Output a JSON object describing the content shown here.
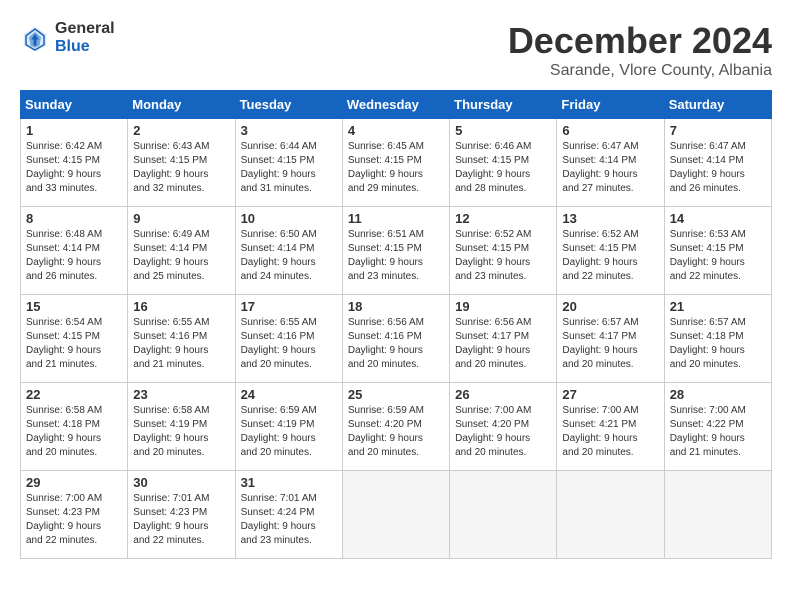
{
  "header": {
    "logo_general": "General",
    "logo_blue": "Blue",
    "month_title": "December 2024",
    "subtitle": "Sarande, Vlore County, Albania"
  },
  "weekdays": [
    "Sunday",
    "Monday",
    "Tuesday",
    "Wednesday",
    "Thursday",
    "Friday",
    "Saturday"
  ],
  "weeks": [
    [
      {
        "day": "1",
        "info": "Sunrise: 6:42 AM\nSunset: 4:15 PM\nDaylight: 9 hours\nand 33 minutes."
      },
      {
        "day": "2",
        "info": "Sunrise: 6:43 AM\nSunset: 4:15 PM\nDaylight: 9 hours\nand 32 minutes."
      },
      {
        "day": "3",
        "info": "Sunrise: 6:44 AM\nSunset: 4:15 PM\nDaylight: 9 hours\nand 31 minutes."
      },
      {
        "day": "4",
        "info": "Sunrise: 6:45 AM\nSunset: 4:15 PM\nDaylight: 9 hours\nand 29 minutes."
      },
      {
        "day": "5",
        "info": "Sunrise: 6:46 AM\nSunset: 4:15 PM\nDaylight: 9 hours\nand 28 minutes."
      },
      {
        "day": "6",
        "info": "Sunrise: 6:47 AM\nSunset: 4:14 PM\nDaylight: 9 hours\nand 27 minutes."
      },
      {
        "day": "7",
        "info": "Sunrise: 6:47 AM\nSunset: 4:14 PM\nDaylight: 9 hours\nand 26 minutes."
      }
    ],
    [
      {
        "day": "8",
        "info": "Sunrise: 6:48 AM\nSunset: 4:14 PM\nDaylight: 9 hours\nand 26 minutes."
      },
      {
        "day": "9",
        "info": "Sunrise: 6:49 AM\nSunset: 4:14 PM\nDaylight: 9 hours\nand 25 minutes."
      },
      {
        "day": "10",
        "info": "Sunrise: 6:50 AM\nSunset: 4:14 PM\nDaylight: 9 hours\nand 24 minutes."
      },
      {
        "day": "11",
        "info": "Sunrise: 6:51 AM\nSunset: 4:15 PM\nDaylight: 9 hours\nand 23 minutes."
      },
      {
        "day": "12",
        "info": "Sunrise: 6:52 AM\nSunset: 4:15 PM\nDaylight: 9 hours\nand 23 minutes."
      },
      {
        "day": "13",
        "info": "Sunrise: 6:52 AM\nSunset: 4:15 PM\nDaylight: 9 hours\nand 22 minutes."
      },
      {
        "day": "14",
        "info": "Sunrise: 6:53 AM\nSunset: 4:15 PM\nDaylight: 9 hours\nand 22 minutes."
      }
    ],
    [
      {
        "day": "15",
        "info": "Sunrise: 6:54 AM\nSunset: 4:15 PM\nDaylight: 9 hours\nand 21 minutes."
      },
      {
        "day": "16",
        "info": "Sunrise: 6:55 AM\nSunset: 4:16 PM\nDaylight: 9 hours\nand 21 minutes."
      },
      {
        "day": "17",
        "info": "Sunrise: 6:55 AM\nSunset: 4:16 PM\nDaylight: 9 hours\nand 20 minutes."
      },
      {
        "day": "18",
        "info": "Sunrise: 6:56 AM\nSunset: 4:16 PM\nDaylight: 9 hours\nand 20 minutes."
      },
      {
        "day": "19",
        "info": "Sunrise: 6:56 AM\nSunset: 4:17 PM\nDaylight: 9 hours\nand 20 minutes."
      },
      {
        "day": "20",
        "info": "Sunrise: 6:57 AM\nSunset: 4:17 PM\nDaylight: 9 hours\nand 20 minutes."
      },
      {
        "day": "21",
        "info": "Sunrise: 6:57 AM\nSunset: 4:18 PM\nDaylight: 9 hours\nand 20 minutes."
      }
    ],
    [
      {
        "day": "22",
        "info": "Sunrise: 6:58 AM\nSunset: 4:18 PM\nDaylight: 9 hours\nand 20 minutes."
      },
      {
        "day": "23",
        "info": "Sunrise: 6:58 AM\nSunset: 4:19 PM\nDaylight: 9 hours\nand 20 minutes."
      },
      {
        "day": "24",
        "info": "Sunrise: 6:59 AM\nSunset: 4:19 PM\nDaylight: 9 hours\nand 20 minutes."
      },
      {
        "day": "25",
        "info": "Sunrise: 6:59 AM\nSunset: 4:20 PM\nDaylight: 9 hours\nand 20 minutes."
      },
      {
        "day": "26",
        "info": "Sunrise: 7:00 AM\nSunset: 4:20 PM\nDaylight: 9 hours\nand 20 minutes."
      },
      {
        "day": "27",
        "info": "Sunrise: 7:00 AM\nSunset: 4:21 PM\nDaylight: 9 hours\nand 20 minutes."
      },
      {
        "day": "28",
        "info": "Sunrise: 7:00 AM\nSunset: 4:22 PM\nDaylight: 9 hours\nand 21 minutes."
      }
    ],
    [
      {
        "day": "29",
        "info": "Sunrise: 7:00 AM\nSunset: 4:23 PM\nDaylight: 9 hours\nand 22 minutes."
      },
      {
        "day": "30",
        "info": "Sunrise: 7:01 AM\nSunset: 4:23 PM\nDaylight: 9 hours\nand 22 minutes."
      },
      {
        "day": "31",
        "info": "Sunrise: 7:01 AM\nSunset: 4:24 PM\nDaylight: 9 hours\nand 23 minutes."
      },
      {
        "day": "",
        "info": ""
      },
      {
        "day": "",
        "info": ""
      },
      {
        "day": "",
        "info": ""
      },
      {
        "day": "",
        "info": ""
      }
    ]
  ]
}
